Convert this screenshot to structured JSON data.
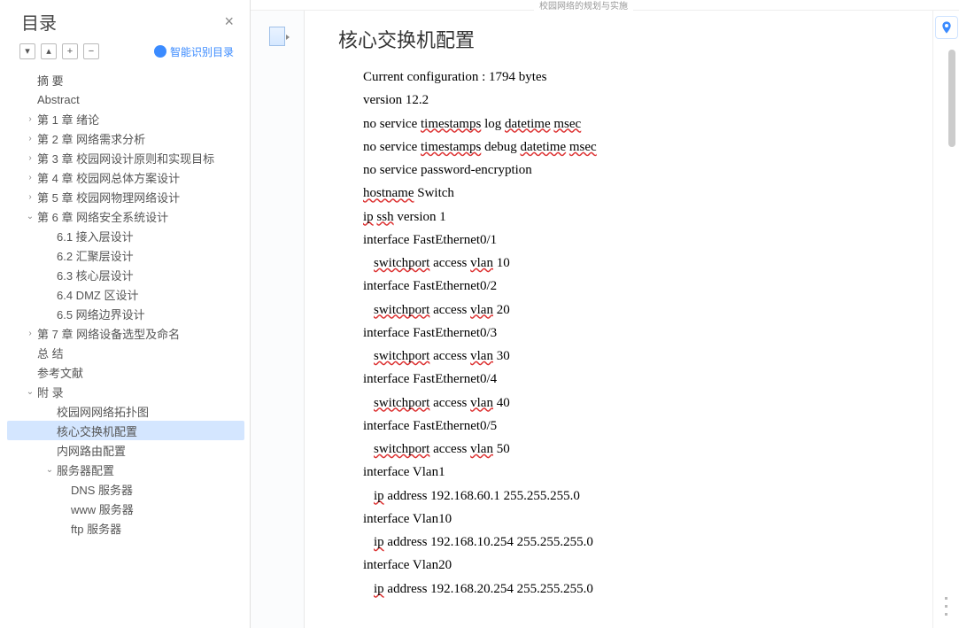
{
  "sidebar": {
    "title": "目录",
    "smart_toc": "智能识别目录",
    "toolbar": [
      "▾",
      "▴",
      "+",
      "−"
    ],
    "items": [
      {
        "label": "摘  要",
        "level": 0,
        "caret": ""
      },
      {
        "label": "Abstract",
        "level": 0,
        "caret": ""
      },
      {
        "label": "第 1 章  绪论",
        "level": 1,
        "caret": "›"
      },
      {
        "label": "第 2 章  网络需求分析",
        "level": 1,
        "caret": "›"
      },
      {
        "label": "第 3 章  校园网设计原则和实现目标",
        "level": 1,
        "caret": "›"
      },
      {
        "label": "第 4 章  校园网总体方案设计",
        "level": 1,
        "caret": "›"
      },
      {
        "label": "第 5 章  校园网物理网络设计",
        "level": 1,
        "caret": "›"
      },
      {
        "label": "第 6 章  网络安全系统设计",
        "level": 1,
        "caret": "⌄"
      },
      {
        "label": "6.1 接入层设计",
        "level": 2,
        "caret": ""
      },
      {
        "label": "6.2 汇聚层设计",
        "level": 2,
        "caret": ""
      },
      {
        "label": "6.3 核心层设计",
        "level": 2,
        "caret": ""
      },
      {
        "label": "6.4 DMZ 区设计",
        "level": 2,
        "caret": ""
      },
      {
        "label": "6.5 网络边界设计",
        "level": 2,
        "caret": ""
      },
      {
        "label": "第 7 章  网络设备选型及命名",
        "level": 1,
        "caret": "›"
      },
      {
        "label": "总  结",
        "level": 0,
        "caret": ""
      },
      {
        "label": "参考文献",
        "level": 0,
        "caret": ""
      },
      {
        "label": "附  录",
        "level": 1,
        "caret": "⌄"
      },
      {
        "label": "校园网网络拓扑图",
        "level": 2,
        "caret": ""
      },
      {
        "label": "核心交换机配置",
        "level": 2,
        "caret": "",
        "selected": true
      },
      {
        "label": "内网路由配置",
        "level": 2,
        "caret": ""
      },
      {
        "label": "服务器配置",
        "level": 2,
        "caret": "⌄"
      },
      {
        "label": "DNS 服务器",
        "level": 3,
        "caret": ""
      },
      {
        "label": "www 服务器",
        "level": 3,
        "caret": ""
      },
      {
        "label": "ftp 服务器",
        "level": 3,
        "caret": ""
      }
    ]
  },
  "doc": {
    "tab_hint": "校园网络的规划与实施",
    "heading": "核心交换机配置",
    "lines": [
      {
        "t": "Current configuration : 1794 bytes",
        "i": 1,
        "sq": []
      },
      {
        "t": "version 12.2",
        "i": 1,
        "sq": []
      },
      {
        "t": "no service timestamps log datetime msec",
        "i": 1,
        "sq": [
          "timestamps",
          "datetime",
          "msec"
        ]
      },
      {
        "t": "no service timestamps debug datetime msec",
        "i": 1,
        "sq": [
          "timestamps",
          "datetime",
          "msec"
        ]
      },
      {
        "t": "no service password-encryption",
        "i": 1,
        "sq": []
      },
      {
        "t": "hostname Switch",
        "i": 1,
        "sq": [
          "hostname"
        ]
      },
      {
        "t": "ip ssh version 1",
        "i": 1,
        "sq": [
          "ip",
          "ssh"
        ]
      },
      {
        "t": "interface FastEthernet0/1",
        "i": 1,
        "sq": []
      },
      {
        "t": "switchport access vlan 10",
        "i": 2,
        "sq": [
          "switchport",
          "vlan"
        ]
      },
      {
        "t": "interface FastEthernet0/2",
        "i": 1,
        "sq": []
      },
      {
        "t": "switchport access vlan 20",
        "i": 2,
        "sq": [
          "switchport",
          "vlan"
        ]
      },
      {
        "t": "interface FastEthernet0/3",
        "i": 1,
        "sq": []
      },
      {
        "t": "switchport access vlan 30",
        "i": 2,
        "sq": [
          "switchport",
          "vlan"
        ]
      },
      {
        "t": "interface FastEthernet0/4",
        "i": 1,
        "sq": []
      },
      {
        "t": "switchport access vlan 40",
        "i": 2,
        "sq": [
          "switchport",
          "vlan"
        ]
      },
      {
        "t": "interface FastEthernet0/5",
        "i": 1,
        "sq": []
      },
      {
        "t": "switchport access vlan 50",
        "i": 2,
        "sq": [
          "switchport",
          "vlan"
        ]
      },
      {
        "t": "interface Vlan1",
        "i": 1,
        "sq": []
      },
      {
        "t": "ip address 192.168.60.1 255.255.255.0",
        "i": 2,
        "sq": [
          "ip"
        ]
      },
      {
        "t": "interface Vlan10",
        "i": 1,
        "sq": []
      },
      {
        "t": "ip address 192.168.10.254 255.255.255.0",
        "i": 2,
        "sq": [
          "ip"
        ]
      },
      {
        "t": "interface Vlan20",
        "i": 1,
        "sq": []
      },
      {
        "t": "ip address 192.168.20.254 255.255.255.0",
        "i": 2,
        "sq": [
          "ip"
        ]
      }
    ]
  }
}
